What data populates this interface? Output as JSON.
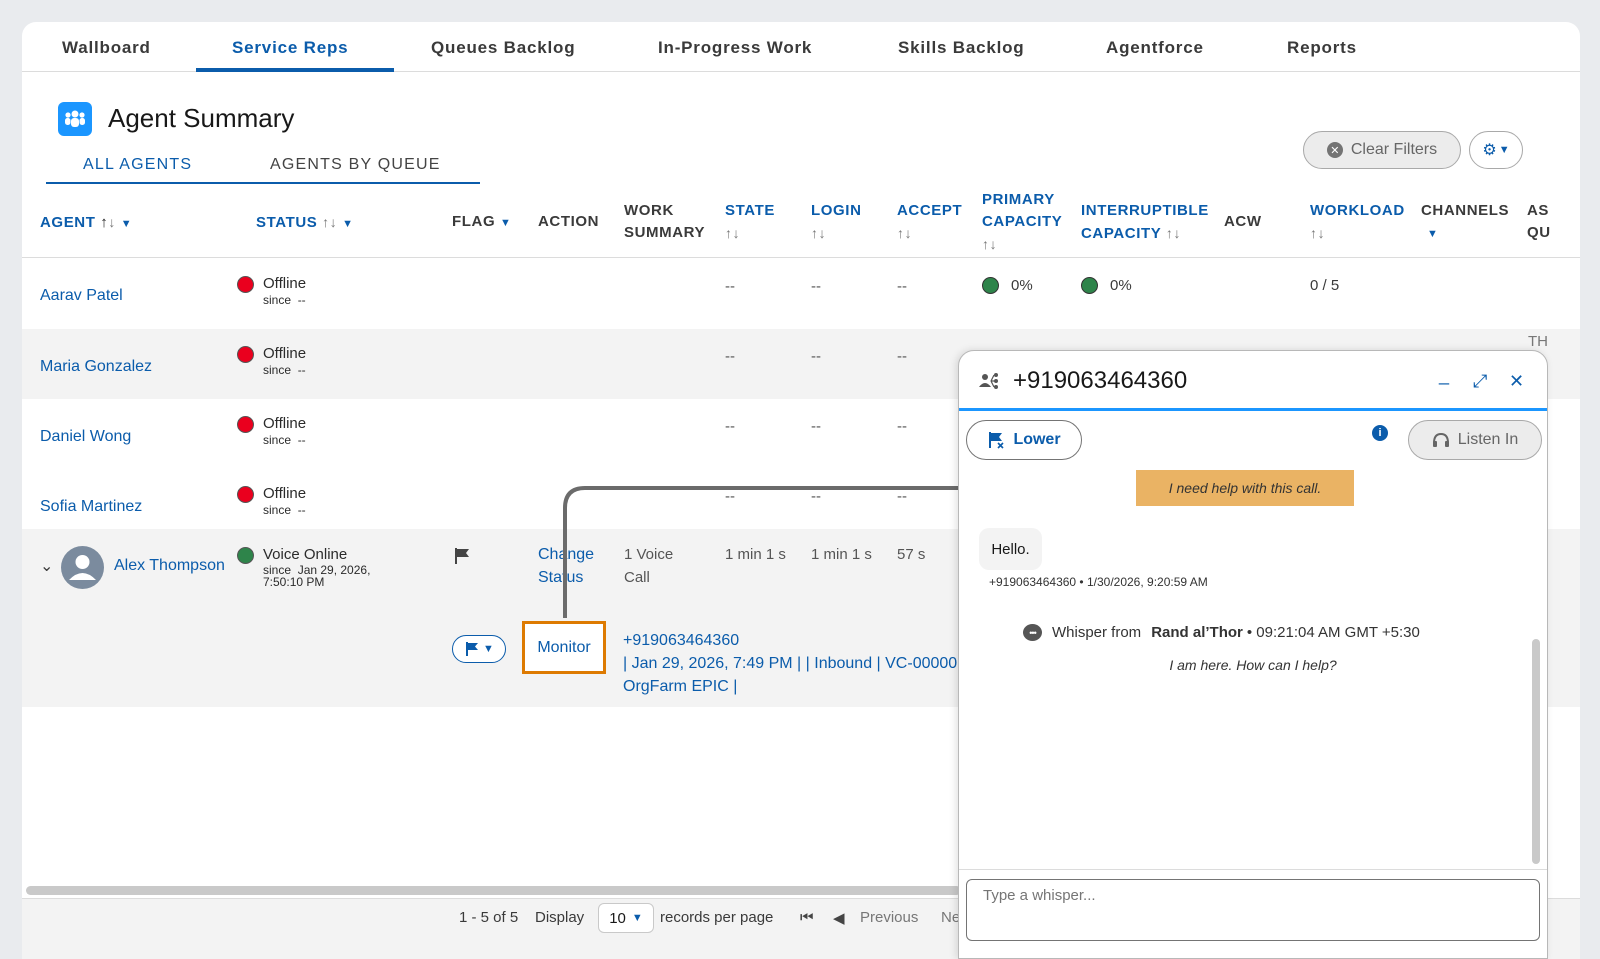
{
  "top_tabs": [
    "Wallboard",
    "Service Reps",
    "Queues Backlog",
    "In-Progress Work",
    "Skills Backlog",
    "Agentforce",
    "Reports"
  ],
  "page_title": "Agent Summary",
  "sub_tabs": [
    "ALL AGENTS",
    "AGENTS BY QUEUE"
  ],
  "clear_filters_label": "Clear Filters",
  "columns": {
    "agent": "AGENT",
    "status": "STATUS",
    "flag": "FLAG",
    "action": "ACTION",
    "work_summary_1": "WORK",
    "work_summary_2": "SUMMARY",
    "state": "STATE",
    "login": "LOGIN",
    "accept": "ACCEPT",
    "primary_capacity_1": "PRIMARY",
    "primary_capacity_2": "CAPACITY",
    "interruptible_capacity_1": "INTERRUPTIBLE",
    "interruptible_capacity_2": "CAPACITY",
    "acw": "ACW",
    "workload": "WORKLOAD",
    "channels": "CHANNELS",
    "as_qu_1": "AS",
    "as_qu_2": "QU"
  },
  "since_label": "since",
  "rows": [
    {
      "agent": "Aarav Patel",
      "status": "Offline",
      "since": "--",
      "state": "--",
      "login": "--",
      "accept": "--",
      "primary_capacity": "0%",
      "interruptible_capacity": "0%",
      "workload": "0 / 5"
    },
    {
      "agent": "Maria Gonzalez",
      "status": "Offline",
      "since": "--",
      "state": "--",
      "login": "--",
      "accept": "--",
      "peek": "TH"
    },
    {
      "agent": "Daniel Wong",
      "status": "Offline",
      "since": "--",
      "state": "--",
      "login": "--",
      "accept": "--"
    },
    {
      "agent": "Sofia Martinez",
      "status": "Offline",
      "since": "--",
      "state": "--",
      "login": "--",
      "accept": "--"
    },
    {
      "agent": "Alex Thompson",
      "status": "Voice Online",
      "since_line1": "Jan 29, 2026,",
      "since_line2": "7:50:10 PM",
      "action_line1": "Change",
      "action_line2": "Status",
      "work_summary_line1": "1 Voice",
      "work_summary_line2": "Call",
      "state": "1 min 1 s",
      "login": "1 min 1 s",
      "accept": "57 s"
    }
  ],
  "work_item": {
    "monitor_label": "Monitor",
    "line1": "+919063464360",
    "line2": "| Jan 29, 2026, 7:49 PM | | Inbound | VC-00000",
    "line3": "OrgFarm EPIC |"
  },
  "footer": {
    "range": "1 - 5 of 5",
    "display_label": "Display",
    "page_size": "10",
    "records_label": "records per page",
    "previous_label": "Previous",
    "next_label": "Ne"
  },
  "panel": {
    "title": "+919063464360",
    "lower_label": "Lower",
    "listen_label": "Listen In",
    "help_note": "I need help with this call.",
    "message_text": "Hello.",
    "message_meta": "+919063464360 • 1/30/2026, 9:20:59 AM",
    "whisper_prefix": "Whisper from",
    "whisper_sender": "Rand al’Thor",
    "whisper_time": "• 09:21:04 AM GMT +5:30",
    "whisper_message": "I am here. How can I help?",
    "input_placeholder": "Type a whisper..."
  },
  "colors": {
    "brand_blue": "#0b5cab",
    "offline_red": "#ea001e",
    "online_green": "#2e844a",
    "highlight_orange": "#dd7a01",
    "note_bg": "#eab364"
  },
  "icons": [
    "people-group-icon",
    "x-circle-icon",
    "gear-icon",
    "flag-icon",
    "chevron-down-icon",
    "avatar-icon",
    "transfer-icon",
    "minimize-icon",
    "expand-icon",
    "close-icon",
    "info-icon",
    "headset-icon",
    "chat-bubble-icon",
    "first-page-icon",
    "previous-icon"
  ]
}
